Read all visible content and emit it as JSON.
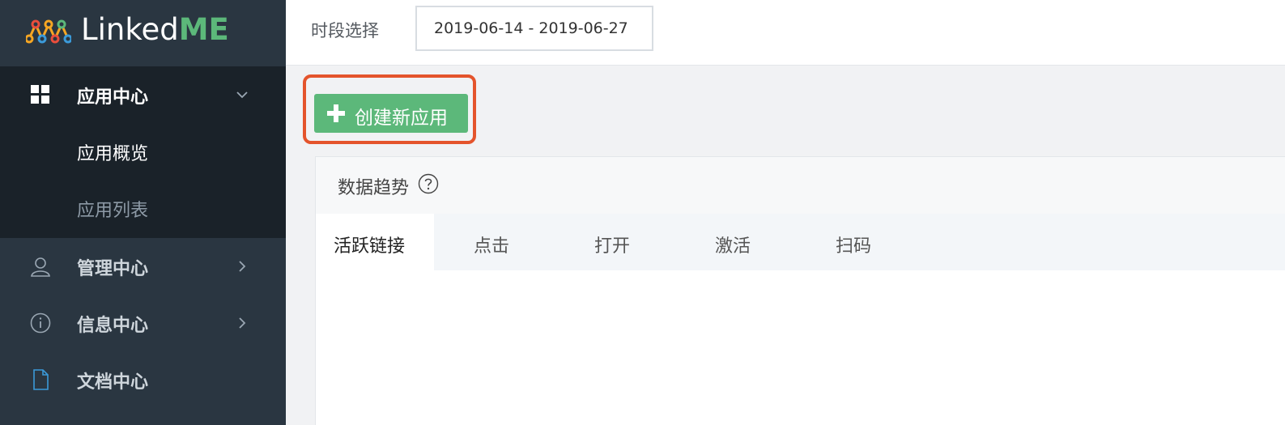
{
  "brand": {
    "name_part1": "Linked",
    "name_part2": "ME",
    "accent": "#5cb87a"
  },
  "sidebar": {
    "items": [
      {
        "label": "应用中心",
        "icon": "grid-icon",
        "expanded": true,
        "children": [
          {
            "label": "应用概览"
          },
          {
            "label": "应用列表"
          }
        ]
      },
      {
        "label": "管理中心",
        "icon": "user-icon"
      },
      {
        "label": "信息中心",
        "icon": "info-icon"
      },
      {
        "label": "文档中心",
        "icon": "document-icon"
      }
    ]
  },
  "topbar": {
    "period_label": "时段选择",
    "date_range": "2019-06-14 - 2019-06-27"
  },
  "actions": {
    "create_app_label": "创建新应用",
    "highlight_color": "#e4542c"
  },
  "panel": {
    "title": "数据趋势",
    "tabs": [
      {
        "label": "活跃链接",
        "active": true
      },
      {
        "label": "点击"
      },
      {
        "label": "打开"
      },
      {
        "label": "激活"
      },
      {
        "label": "扫码"
      }
    ]
  }
}
